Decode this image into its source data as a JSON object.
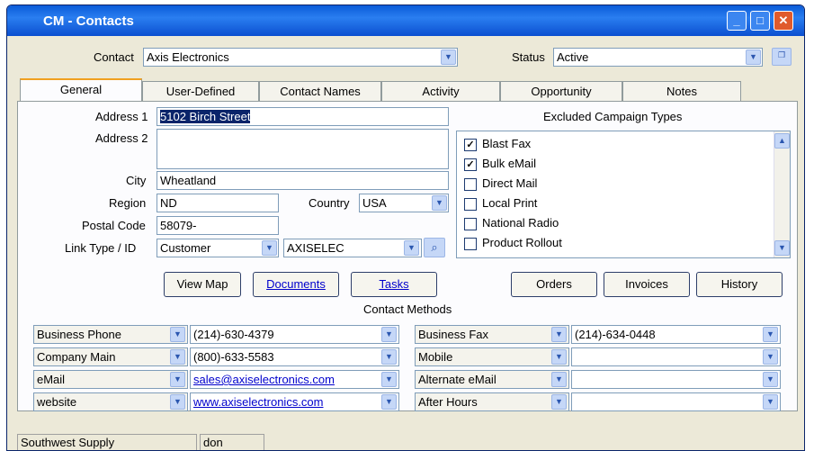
{
  "window": {
    "title": "CM - Contacts"
  },
  "header": {
    "contact_label": "Contact",
    "contact_value": "Axis Electronics",
    "status_label": "Status",
    "status_value": "Active"
  },
  "tabs": [
    {
      "label": "General"
    },
    {
      "label": "User-Defined"
    },
    {
      "label": "Contact Names"
    },
    {
      "label": "Activity"
    },
    {
      "label": "Opportunity"
    },
    {
      "label": "Notes"
    }
  ],
  "address": {
    "address1_label": "Address 1",
    "address1_value": "5102 Birch Street",
    "address2_label": "Address 2",
    "address2_value": "",
    "city_label": "City",
    "city_value": "Wheatland",
    "region_label": "Region",
    "region_value": "ND",
    "country_label": "Country",
    "country_value": "USA",
    "postal_label": "Postal Code",
    "postal_value": "58079-",
    "link_label": "Link Type / ID",
    "link_type_value": "Customer",
    "link_id_value": "AXISELEC"
  },
  "campaign": {
    "title": "Excluded Campaign Types",
    "items": [
      {
        "label": "Blast Fax",
        "checked": true
      },
      {
        "label": "Bulk eMail",
        "checked": true
      },
      {
        "label": "Direct Mail",
        "checked": false
      },
      {
        "label": "Local Print",
        "checked": false
      },
      {
        "label": "National Radio",
        "checked": false
      },
      {
        "label": "Product Rollout",
        "checked": false
      }
    ]
  },
  "buttons": {
    "view_map": "View Map",
    "documents": "Documents",
    "tasks": "Tasks",
    "orders": "Orders",
    "invoices": "Invoices",
    "history": "History"
  },
  "contact_methods": {
    "title": "Contact Methods",
    "left": [
      {
        "type": "Business Phone",
        "value": "(214)-630-4379"
      },
      {
        "type": "Company Main",
        "value": "(800)-633-5583"
      },
      {
        "type": "eMail",
        "value": "sales@axiselectronics.com"
      },
      {
        "type": "website",
        "value": "www.axiselectronics.com"
      }
    ],
    "right": [
      {
        "type": "Business Fax",
        "value": "(214)-634-0448"
      },
      {
        "type": "Mobile",
        "value": ""
      },
      {
        "type": "Alternate eMail",
        "value": ""
      },
      {
        "type": "After Hours",
        "value": ""
      }
    ]
  },
  "statusbar": {
    "company": "Southwest Supply",
    "user": "don"
  }
}
